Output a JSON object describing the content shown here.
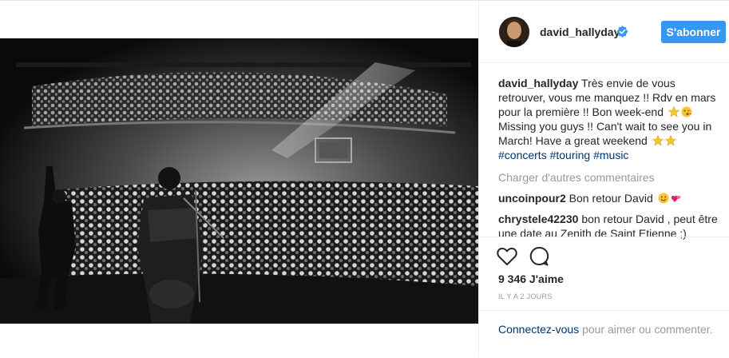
{
  "header": {
    "username": "david_hallyday",
    "follow_label": "S'abonner"
  },
  "caption": {
    "username": "david_hallyday",
    "text_fr": "Très envie de vous retrouver, vous me manquez !! Rdv en mars pour la première !! Bon week-end",
    "text_en": "Missing you guys !! Can't wait to see you in March! Have a great weekend",
    "hashtags": [
      "#concerts",
      "#touring",
      "#music"
    ]
  },
  "load_more_label": "Charger d'autres commentaires",
  "comments": [
    {
      "username": "uncoinpour2",
      "text": "Bon retour David"
    },
    {
      "username": "chrystele42230",
      "text": "bon retour David , peut être une date au Zenith de Saint Etienne ;)"
    }
  ],
  "likes": "9 346 J'aime",
  "timestamp": "IL Y A 2 JOURS",
  "login": {
    "link_label": "Connectez-vous",
    "rest_label": "pour aimer ou commenter."
  },
  "colors": {
    "accent": "#3897f0",
    "link": "#003569",
    "muted": "#999999"
  },
  "icons": {
    "like": "heart-outline-icon",
    "comment": "speech-bubble-icon",
    "verified": "verified-badge-icon"
  }
}
